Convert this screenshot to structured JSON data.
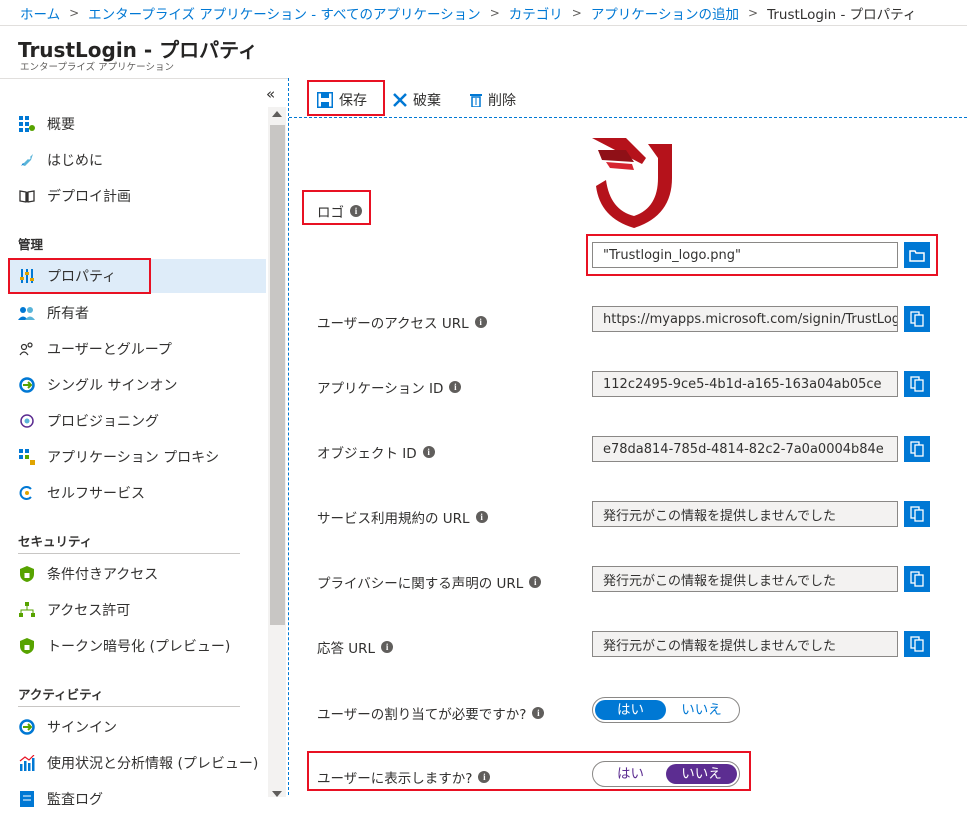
{
  "breadcrumb": {
    "items": [
      "ホーム",
      "エンタープライズ アプリケーション - すべてのアプリケーション",
      "カテゴリ",
      "アプリケーションの追加"
    ],
    "current": "TrustLogin - プロパティ"
  },
  "header": {
    "title": "TrustLogin - プロパティ",
    "subtitle": "エンタープライズ アプリケーション"
  },
  "sidebar": {
    "collapse": "«",
    "top_items": [
      {
        "label": "概要",
        "icon": "overview-grid-icon"
      },
      {
        "label": "はじめに",
        "icon": "rocket-icon"
      },
      {
        "label": "デプロイ計画",
        "icon": "book-icon"
      }
    ],
    "sections": [
      {
        "title": "管理",
        "items": [
          {
            "label": "プロパティ",
            "icon": "properties-sliders-icon",
            "active": true
          },
          {
            "label": "所有者",
            "icon": "owners-icon"
          },
          {
            "label": "ユーザーとグループ",
            "icon": "users-groups-icon"
          },
          {
            "label": "シングル サインオン",
            "icon": "single-sign-on-icon"
          },
          {
            "label": "プロビジョニング",
            "icon": "provisioning-icon"
          },
          {
            "label": "アプリケーション プロキシ",
            "icon": "app-proxy-icon"
          },
          {
            "label": "セルフサービス",
            "icon": "self-service-icon"
          }
        ]
      },
      {
        "title": "セキュリティ",
        "items": [
          {
            "label": "条件付きアクセス",
            "icon": "shield-lock-icon"
          },
          {
            "label": "アクセス許可",
            "icon": "permissions-tree-icon"
          },
          {
            "label": "トークン暗号化 (プレビュー)",
            "icon": "token-shield-icon"
          }
        ]
      },
      {
        "title": "アクティビティ",
        "items": [
          {
            "label": "サインイン",
            "icon": "sign-in-icon"
          },
          {
            "label": "使用状況と分析情報 (プレビュー)",
            "icon": "usage-chart-icon"
          },
          {
            "label": "監査ログ",
            "icon": "audit-log-icon"
          }
        ]
      }
    ]
  },
  "toolbar": {
    "save": "保存",
    "discard": "破棄",
    "delete": "削除"
  },
  "form": {
    "logo_label": "ロゴ",
    "logo_value": "\"Trustlogin_logo.png\"",
    "fields": [
      {
        "label": "ユーザーのアクセス URL",
        "value": "https://myapps.microsoft.com/signin/TrustLog..."
      },
      {
        "label": "アプリケーション ID",
        "value": "112c2495-9ce5-4b1d-a165-163a04ab05ce"
      },
      {
        "label": "オブジェクト ID",
        "value": "e78da814-785d-4814-82c2-7a0a0004b84e"
      },
      {
        "label": "サービス利用規約の URL",
        "value": "発行元がこの情報を提供しませんでした"
      },
      {
        "label": "プライバシーに関する声明の URL",
        "value": "発行元がこの情報を提供しませんでした"
      },
      {
        "label": "応答 URL",
        "value": "発行元がこの情報を提供しませんでした"
      }
    ],
    "assignment_required": {
      "label": "ユーザーの割り当てが必要ですか?",
      "yes": "はい",
      "no": "いいえ",
      "selected": "yes"
    },
    "visible_to_users": {
      "label": "ユーザーに表示しますか?",
      "yes": "はい",
      "no": "いいえ",
      "selected": "no"
    }
  },
  "colors": {
    "accent": "#0078d4",
    "highlight": "#e81123",
    "toggle_no": "#5c2d91",
    "logo_red": "#b5121b"
  }
}
